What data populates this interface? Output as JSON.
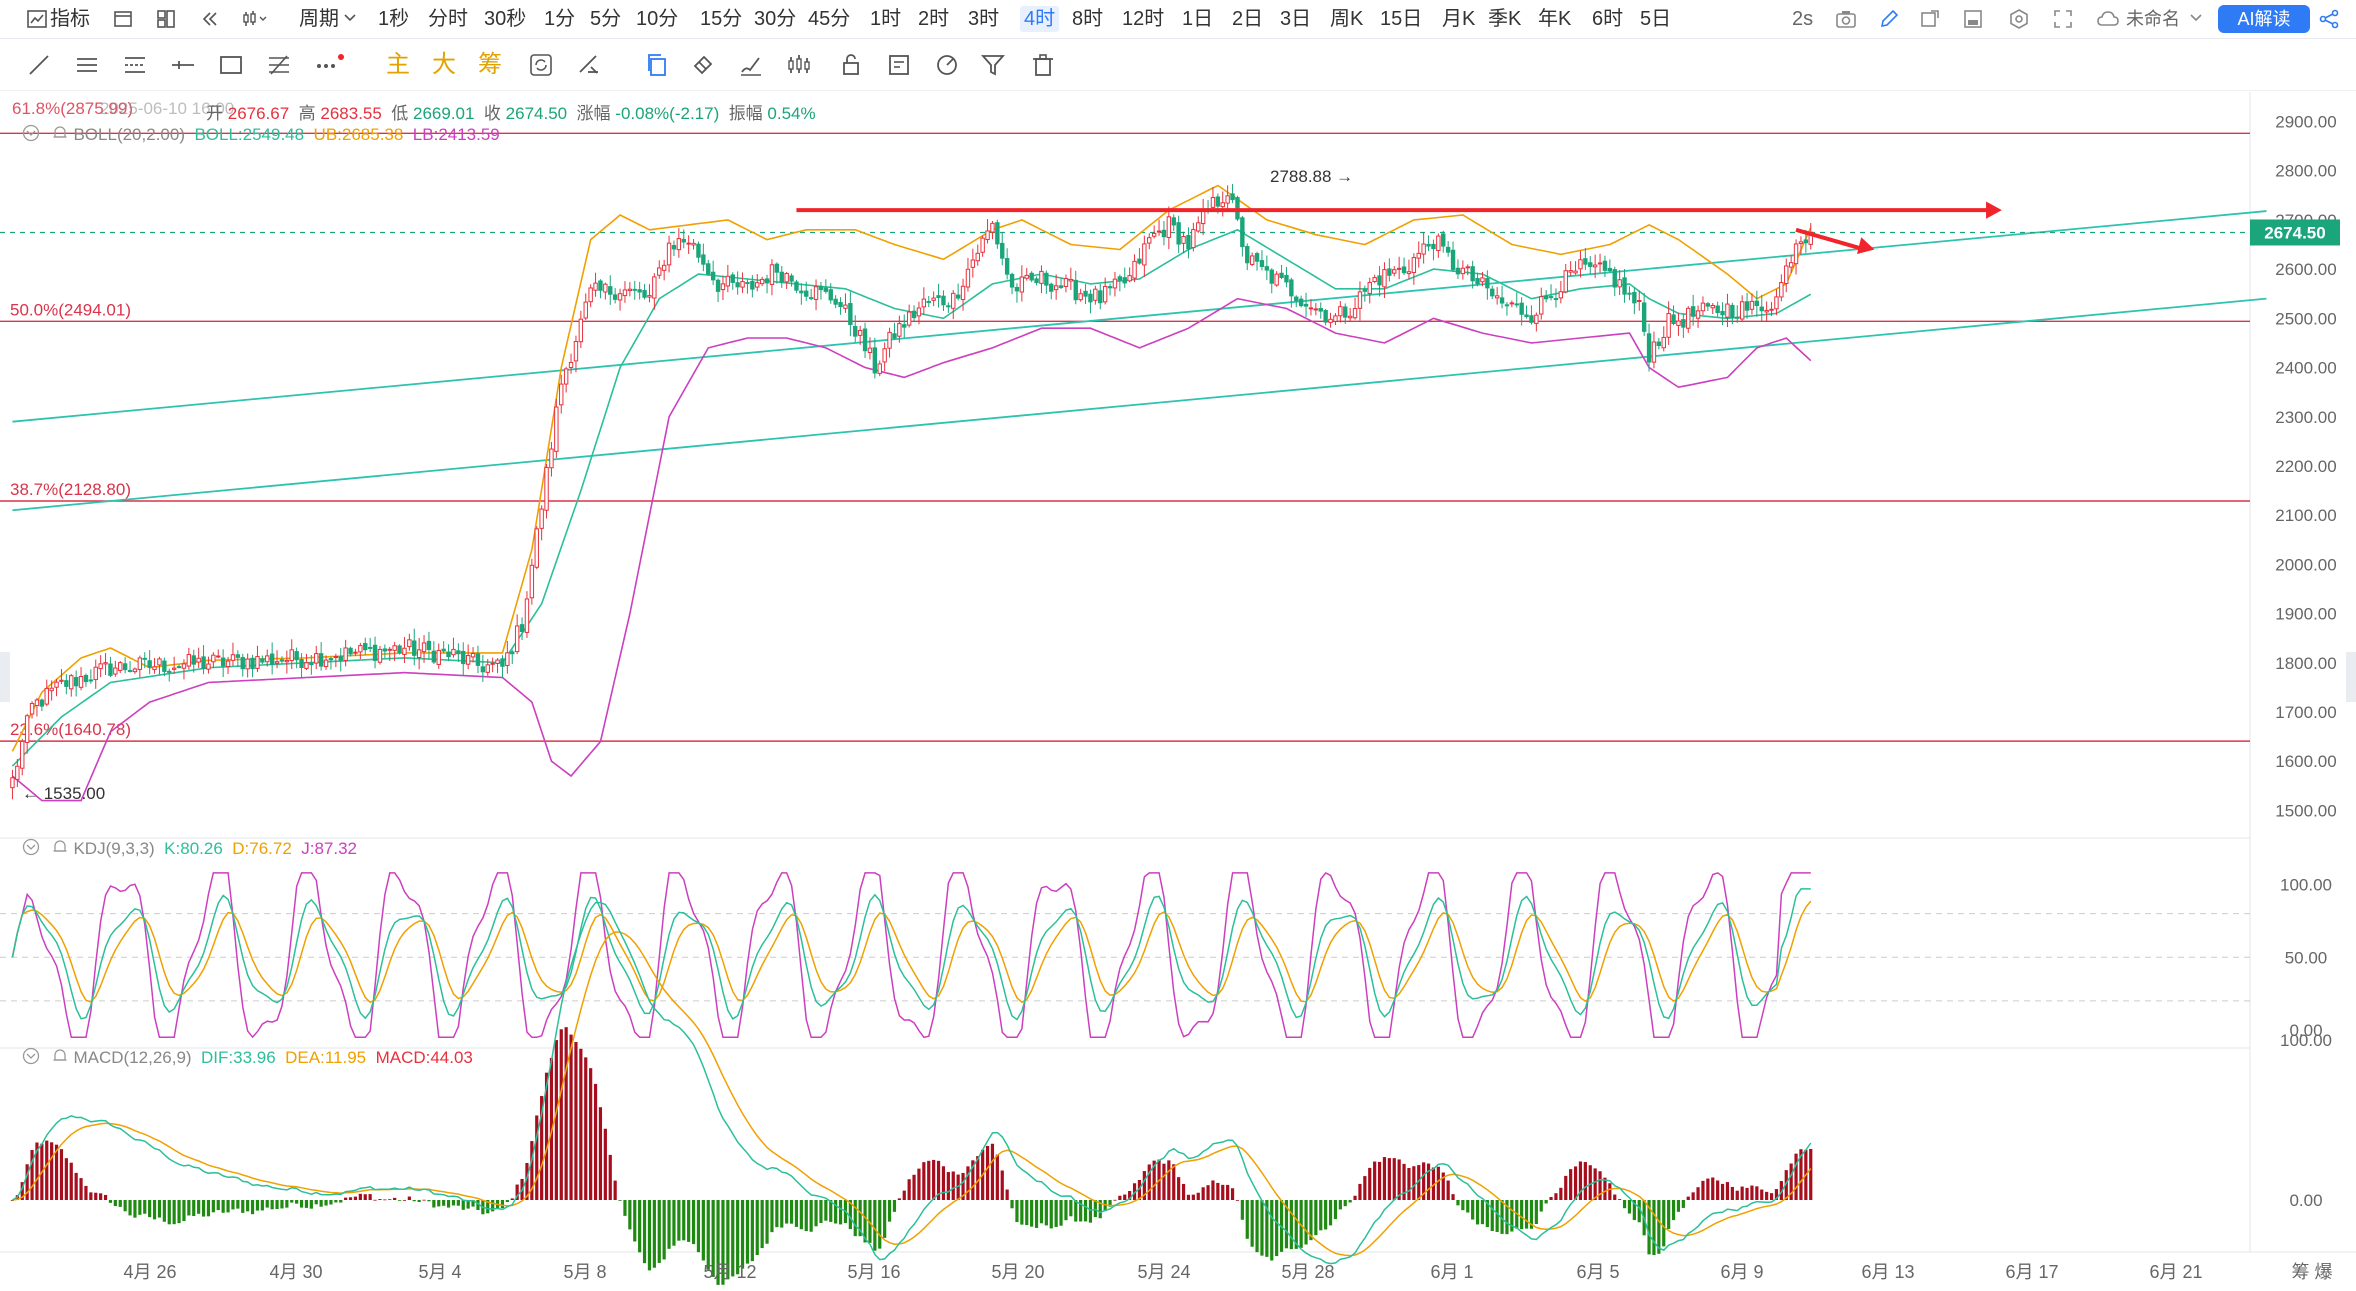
{
  "topbar": {
    "indicator_label": "指标",
    "period_label": "周期",
    "intervals": [
      "1秒",
      "分时",
      "30秒",
      "1分",
      "5分",
      "10分",
      "15分",
      "30分",
      "45分",
      "1时",
      "2时",
      "3时",
      "4时",
      "8时",
      "12时",
      "1日",
      "2日",
      "3日",
      "周K",
      "15日",
      "月K",
      "季K",
      "年K",
      "6时",
      "5日"
    ],
    "active_interval": "4时",
    "refresh_label": "2s",
    "unnamed_label": "未命名",
    "ai_label": "AI解读"
  },
  "drawtools": {
    "main_label": "主",
    "big_label": "大",
    "chip_label": "筹"
  },
  "ohlc": {
    "fib_overlap_label": "61.8%(2875.99)",
    "date": "2025-06-10 16:00",
    "open_label": "开",
    "open": "2676.67",
    "high_label": "高",
    "high": "2683.55",
    "low_label": "低",
    "low": "2669.01",
    "close_label": "收",
    "close": "2674.50",
    "change_label": "涨幅",
    "change": "-0.08%(-2.17)",
    "amp_label": "振幅",
    "amp": "0.54%"
  },
  "boll": {
    "name": "BOLL(20,2.00)",
    "boll": "BOLL:2549.48",
    "ub": "UB:2685.38",
    "lb": "LB:2413.59"
  },
  "kdj": {
    "name": "KDJ(9,3,3)",
    "k": "K:80.26",
    "d": "D:76.72",
    "j": "J:87.32"
  },
  "macd": {
    "name": "MACD(12,26,9)",
    "dif": "DIF:33.96",
    "dea": "DEA:11.95",
    "macd": "MACD:44.03"
  },
  "colors": {
    "up": "#e8313d",
    "down": "#1aa57a",
    "boll_mid": "#2bbf9a",
    "boll_ub": "#f0a000",
    "boll_lb": "#cc3fbf",
    "fib": "#d9344a",
    "trend": "#2dc3b0",
    "arrow": "#f0242a",
    "macd_up": "#a60d1d",
    "macd_down": "#1e8a12"
  },
  "chart_data": {
    "type": "candlestick",
    "price_axis": {
      "range": [
        1450,
        2960
      ],
      "ticks": [
        "2900.00",
        "2800.00",
        "2700.00",
        "2600.00",
        "2500.00",
        "2400.00",
        "2300.00",
        "2200.00",
        "2100.00",
        "2000.00",
        "1900.00",
        "1800.00",
        "1700.00",
        "1600.00",
        "1500.00"
      ]
    },
    "current_price": "2674.50",
    "annotations": {
      "high_label": "2788.88",
      "low_label": "1535.00"
    },
    "fib_levels": [
      {
        "label": "61.8%(2875.99)",
        "value": 2875.99,
        "show_label": false
      },
      {
        "label": "50.0%(2494.01)",
        "value": 2494.01,
        "show_label": true
      },
      {
        "label": "38.7%(2128.80)",
        "value": 2128.8,
        "show_label": true
      },
      {
        "label": "23.6%(1640.78)",
        "value": 1640.78,
        "show_label": true
      }
    ],
    "x_axis": {
      "labels": [
        "4月 26",
        "4月 30",
        "5月 4",
        "5月 8",
        "5月 12",
        "5月 16",
        "5月 20",
        "5月 24",
        "5月 28",
        "6月 1",
        "6月 5",
        "6月 9",
        "6月 13",
        "6月 17",
        "6月 21"
      ],
      "right_label": "筹 爆"
    },
    "close_anchors": [
      [
        0,
        1560
      ],
      [
        4,
        1710
      ],
      [
        10,
        1755
      ],
      [
        20,
        1790
      ],
      [
        30,
        1795
      ],
      [
        40,
        1800
      ],
      [
        50,
        1805
      ],
      [
        60,
        1810
      ],
      [
        70,
        1820
      ],
      [
        80,
        1830
      ],
      [
        90,
        1815
      ],
      [
        95,
        1795
      ],
      [
        100,
        1790
      ],
      [
        104,
        1880
      ],
      [
        108,
        2120
      ],
      [
        112,
        2370
      ],
      [
        118,
        2550
      ],
      [
        124,
        2560
      ],
      [
        130,
        2540
      ],
      [
        134,
        2650
      ],
      [
        138,
        2660
      ],
      [
        144,
        2570
      ],
      [
        150,
        2560
      ],
      [
        156,
        2600
      ],
      [
        162,
        2560
      ],
      [
        168,
        2540
      ],
      [
        172,
        2480
      ],
      [
        176,
        2400
      ],
      [
        180,
        2470
      ],
      [
        186,
        2530
      ],
      [
        192,
        2540
      ],
      [
        196,
        2620
      ],
      [
        200,
        2690
      ],
      [
        204,
        2560
      ],
      [
        210,
        2580
      ],
      [
        216,
        2560
      ],
      [
        222,
        2540
      ],
      [
        228,
        2580
      ],
      [
        232,
        2660
      ],
      [
        236,
        2690
      ],
      [
        240,
        2650
      ],
      [
        244,
        2720
      ],
      [
        248,
        2760
      ],
      [
        252,
        2620
      ],
      [
        256,
        2590
      ],
      [
        262,
        2550
      ],
      [
        266,
        2520
      ],
      [
        270,
        2500
      ],
      [
        274,
        2530
      ],
      [
        278,
        2580
      ],
      [
        284,
        2600
      ],
      [
        290,
        2660
      ],
      [
        294,
        2610
      ],
      [
        298,
        2580
      ],
      [
        304,
        2530
      ],
      [
        310,
        2510
      ],
      [
        316,
        2570
      ],
      [
        320,
        2600
      ],
      [
        326,
        2590
      ],
      [
        332,
        2520
      ],
      [
        334,
        2430
      ],
      [
        338,
        2490
      ],
      [
        344,
        2510
      ],
      [
        350,
        2520
      ],
      [
        356,
        2520
      ],
      [
        360,
        2540
      ],
      [
        364,
        2660
      ],
      [
        367,
        2675
      ]
    ],
    "boll_mid_anchors": [
      [
        0,
        1590
      ],
      [
        10,
        1690
      ],
      [
        20,
        1760
      ],
      [
        40,
        1790
      ],
      [
        60,
        1800
      ],
      [
        80,
        1810
      ],
      [
        100,
        1800
      ],
      [
        108,
        1920
      ],
      [
        116,
        2150
      ],
      [
        124,
        2400
      ],
      [
        132,
        2540
      ],
      [
        140,
        2590
      ],
      [
        150,
        2580
      ],
      [
        160,
        2570
      ],
      [
        170,
        2560
      ],
      [
        180,
        2520
      ],
      [
        190,
        2500
      ],
      [
        200,
        2570
      ],
      [
        210,
        2590
      ],
      [
        220,
        2570
      ],
      [
        230,
        2580
      ],
      [
        240,
        2640
      ],
      [
        250,
        2680
      ],
      [
        260,
        2620
      ],
      [
        270,
        2560
      ],
      [
        280,
        2560
      ],
      [
        290,
        2600
      ],
      [
        300,
        2590
      ],
      [
        310,
        2540
      ],
      [
        320,
        2560
      ],
      [
        330,
        2570
      ],
      [
        334,
        2540
      ],
      [
        340,
        2510
      ],
      [
        350,
        2500
      ],
      [
        360,
        2510
      ],
      [
        367,
        2549
      ]
    ],
    "boll_ub_anchors": [
      [
        0,
        1620
      ],
      [
        6,
        1740
      ],
      [
        14,
        1810
      ],
      [
        20,
        1830
      ],
      [
        28,
        1790
      ],
      [
        40,
        1805
      ],
      [
        60,
        1810
      ],
      [
        80,
        1820
      ],
      [
        100,
        1820
      ],
      [
        106,
        2030
      ],
      [
        112,
        2400
      ],
      [
        118,
        2660
      ],
      [
        124,
        2710
      ],
      [
        130,
        2680
      ],
      [
        138,
        2690
      ],
      [
        146,
        2700
      ],
      [
        154,
        2660
      ],
      [
        162,
        2680
      ],
      [
        172,
        2680
      ],
      [
        180,
        2650
      ],
      [
        190,
        2620
      ],
      [
        200,
        2680
      ],
      [
        206,
        2700
      ],
      [
        216,
        2650
      ],
      [
        226,
        2640
      ],
      [
        236,
        2720
      ],
      [
        246,
        2770
      ],
      [
        256,
        2700
      ],
      [
        266,
        2670
      ],
      [
        276,
        2650
      ],
      [
        286,
        2700
      ],
      [
        296,
        2710
      ],
      [
        306,
        2650
      ],
      [
        316,
        2630
      ],
      [
        326,
        2650
      ],
      [
        334,
        2690
      ],
      [
        340,
        2660
      ],
      [
        350,
        2590
      ],
      [
        356,
        2540
      ],
      [
        362,
        2570
      ],
      [
        367,
        2685
      ]
    ],
    "boll_lb_anchors": [
      [
        0,
        1570
      ],
      [
        6,
        1520
      ],
      [
        14,
        1520
      ],
      [
        20,
        1660
      ],
      [
        28,
        1720
      ],
      [
        40,
        1760
      ],
      [
        60,
        1770
      ],
      [
        80,
        1780
      ],
      [
        100,
        1770
      ],
      [
        106,
        1720
      ],
      [
        110,
        1600
      ],
      [
        114,
        1570
      ],
      [
        120,
        1640
      ],
      [
        126,
        1900
      ],
      [
        134,
        2300
      ],
      [
        142,
        2440
      ],
      [
        150,
        2460
      ],
      [
        158,
        2460
      ],
      [
        166,
        2440
      ],
      [
        174,
        2400
      ],
      [
        182,
        2380
      ],
      [
        190,
        2410
      ],
      [
        200,
        2440
      ],
      [
        210,
        2480
      ],
      [
        220,
        2480
      ],
      [
        230,
        2440
      ],
      [
        240,
        2480
      ],
      [
        250,
        2540
      ],
      [
        260,
        2520
      ],
      [
        270,
        2470
      ],
      [
        280,
        2450
      ],
      [
        290,
        2500
      ],
      [
        300,
        2470
      ],
      [
        310,
        2450
      ],
      [
        320,
        2460
      ],
      [
        330,
        2470
      ],
      [
        334,
        2400
      ],
      [
        340,
        2360
      ],
      [
        350,
        2380
      ],
      [
        356,
        2440
      ],
      [
        362,
        2460
      ],
      [
        367,
        2414
      ]
    ],
    "trendlines": [
      {
        "from": [
          0,
          2290
        ],
        "to": [
          460,
          2718
        ]
      },
      {
        "from": [
          0,
          2110
        ],
        "to": [
          460,
          2540
        ]
      }
    ],
    "arrows": [
      {
        "from": [
          160,
          2720
        ],
        "to": [
          406,
          2720
        ]
      },
      {
        "from": [
          364,
          2680
        ],
        "to": [
          380,
          2640
        ]
      }
    ],
    "kdj": {
      "y_ticks": [
        "100.00",
        "50.00",
        "0.00"
      ],
      "dash_levels": [
        80,
        50,
        20
      ]
    },
    "macd": {
      "y_ticks": [
        "100.00",
        "0.00"
      ]
    }
  }
}
